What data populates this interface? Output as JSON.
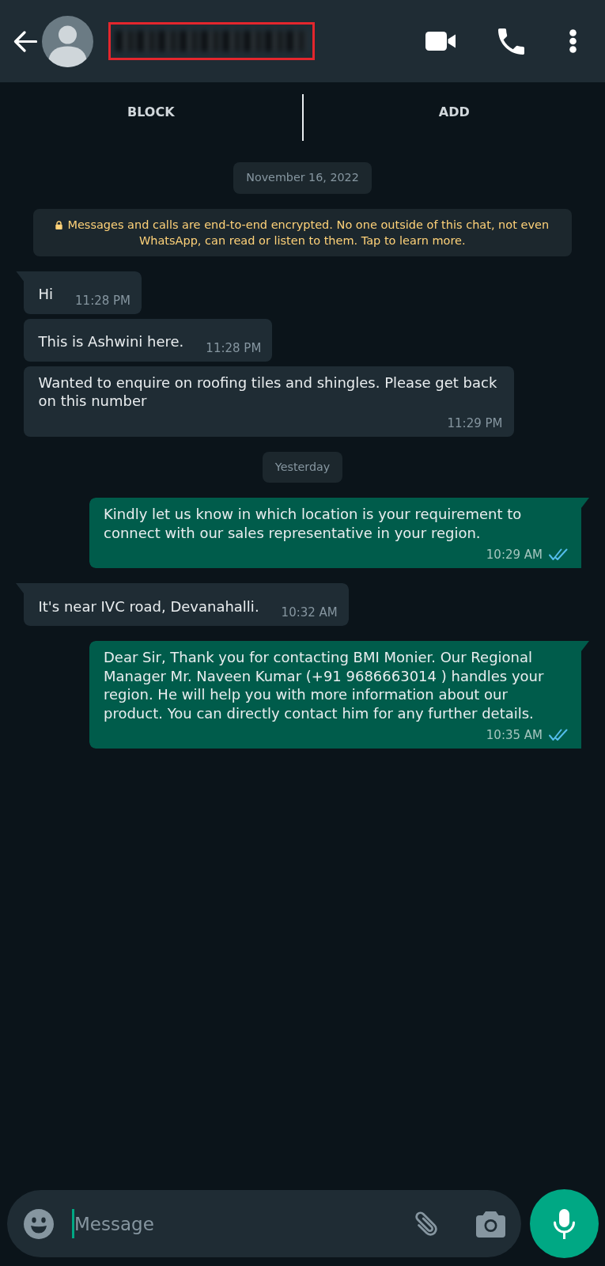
{
  "actions": [
    {
      "label": "BLOCK"
    },
    {
      "label": "ADD"
    }
  ],
  "chat": [
    {
      "kind": "date",
      "text": "November 16, 2022"
    },
    {
      "kind": "notice",
      "text": "Messages and calls are end-to-end encrypted. No one outside of this chat, not even WhatsApp, can read or listen to them. Tap to learn more."
    },
    {
      "kind": "incoming",
      "text": "Hi",
      "time": "11:28 PM",
      "tail": true
    },
    {
      "kind": "incoming",
      "text": "This is Ashwini here.",
      "time": "11:28 PM",
      "tail": false
    },
    {
      "kind": "incoming",
      "text": "Wanted to enquire on roofing tiles and shingles. Please get back on this number",
      "time": "11:29 PM",
      "tail": false
    },
    {
      "kind": "date",
      "text": "Yesterday"
    },
    {
      "kind": "outgoing",
      "text": "Kindly let us know in which location is your requirement to connect with our sales representative in your region.",
      "time": "10:29 AM",
      "read": true,
      "tail": true
    },
    {
      "kind": "incoming",
      "text": "It's near IVC road, Devanahalli.",
      "time": "10:32 AM",
      "tail": true
    },
    {
      "kind": "outgoing",
      "text": "Dear Sir, Thank you for contacting BMI Monier. Our Regional Manager Mr. Naveen Kumar (+91 9686663014 ) handles your region. He will help you with more information about our product. You can directly contact him for any further details.",
      "time": "10:35 AM",
      "read": true,
      "tail": true
    }
  ],
  "composer": {
    "placeholder": "Message"
  }
}
